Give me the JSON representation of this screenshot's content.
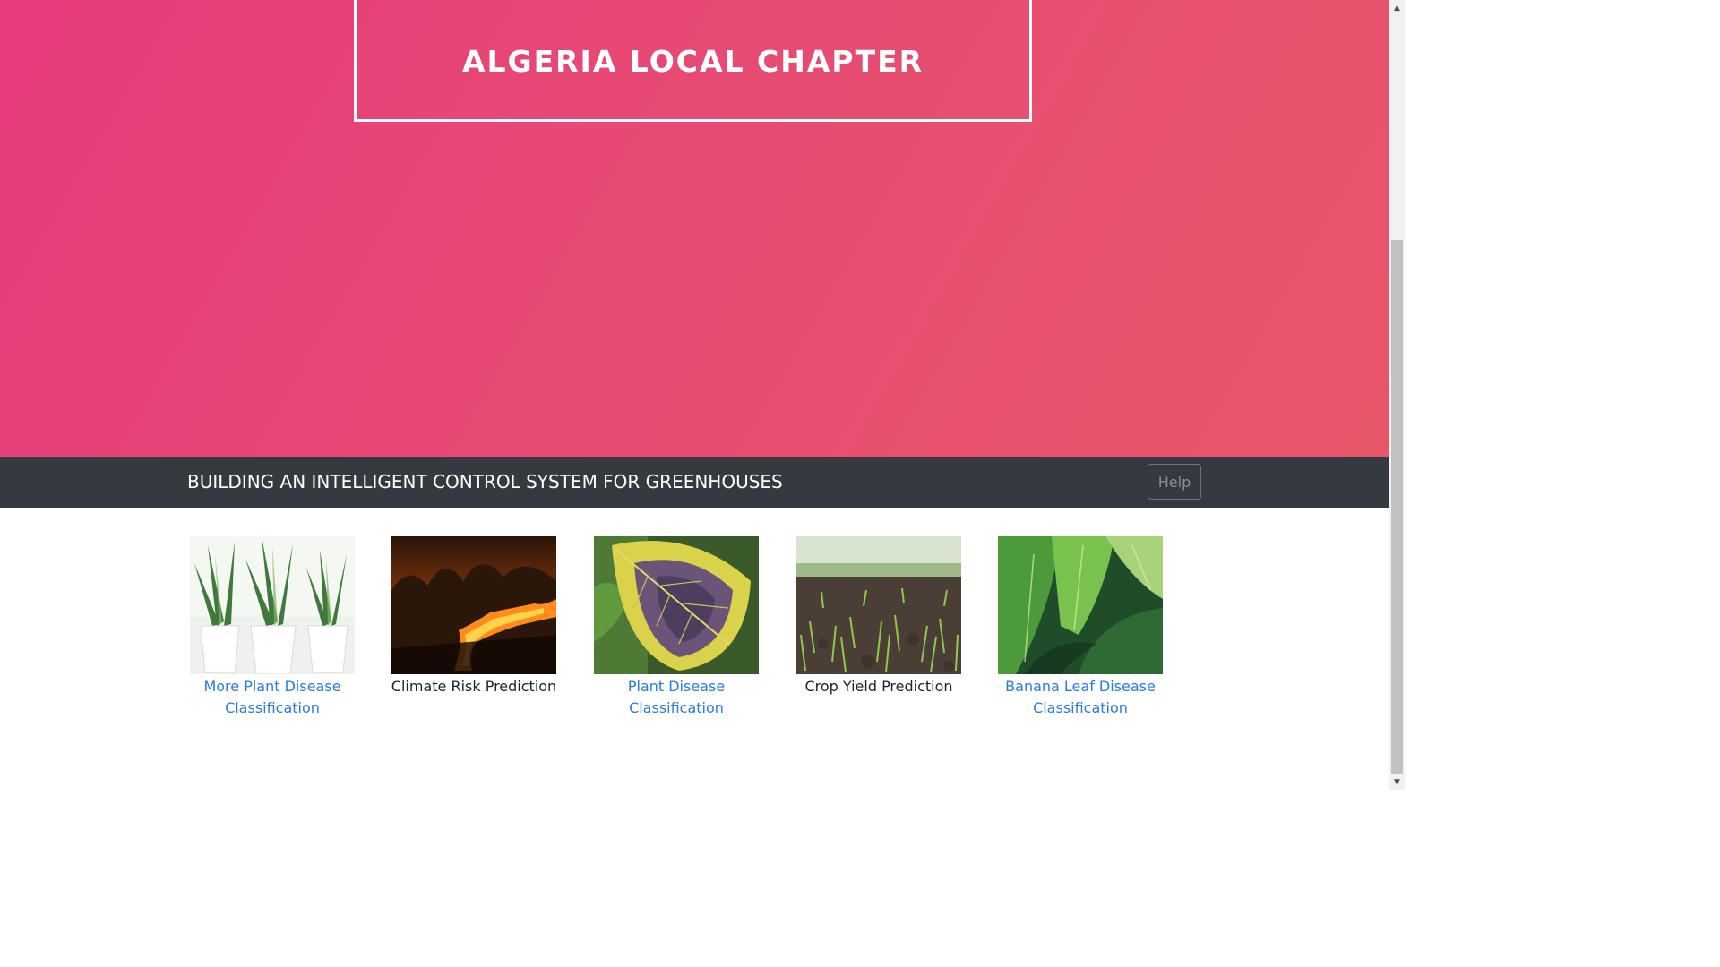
{
  "hero": {
    "title": "ALGERIA LOCAL CHAPTER"
  },
  "navbar": {
    "title": "BUILDING AN INTELLIGENT CONTROL SYSTEM FOR GREENHOUSES",
    "help_label": "Help"
  },
  "cards": [
    {
      "label": "More Plant Disease Classification",
      "is_link": true,
      "image": "snake-plants-photo"
    },
    {
      "label": "Climate Risk Prediction",
      "is_link": false,
      "image": "forest-fire-photo"
    },
    {
      "label": "Plant Disease Classification",
      "is_link": true,
      "image": "diseased-leaf-photo"
    },
    {
      "label": "Crop Yield Prediction",
      "is_link": false,
      "image": "crop-seedlings-photo"
    },
    {
      "label": "Banana Leaf Disease Classification",
      "is_link": true,
      "image": "banana-leaves-photo"
    }
  ],
  "colors": {
    "hero_start": "#e63b7e",
    "hero_end": "#e8566a",
    "navbar": "#343a40",
    "link": "#2a7ae2"
  }
}
